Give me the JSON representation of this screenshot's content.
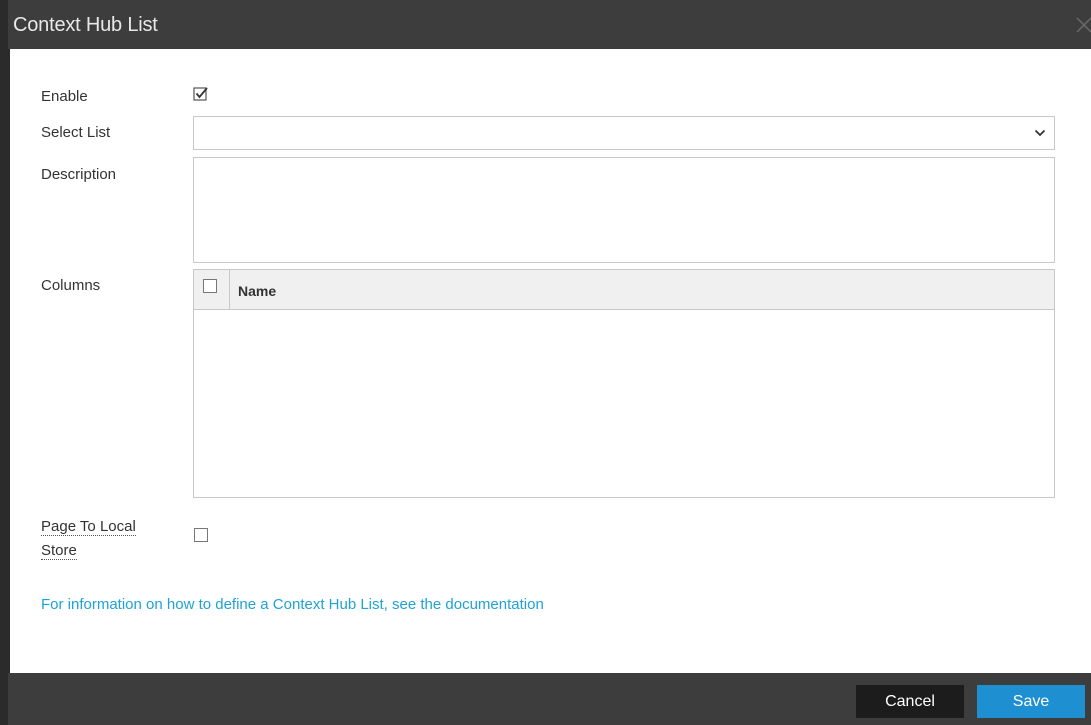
{
  "dialog": {
    "title": "Context Hub List"
  },
  "form": {
    "enable_label": "Enable",
    "select_list_label": "Select List",
    "select_list_value": "",
    "description_label": "Description",
    "description_value": "",
    "columns_label": "Columns",
    "columns_header": "Name",
    "page_to_local_store_line1": "Page To Local",
    "page_to_local_store_line2": "Store",
    "enable_checked": true,
    "page_to_local_store_checked": false
  },
  "link": {
    "doc_text": "For information on how to define a Context Hub List, see the documentation"
  },
  "footer": {
    "cancel_label": "Cancel",
    "save_label": "Save"
  },
  "colors": {
    "accent": "#1e8fd1",
    "link": "#1fa2d6",
    "chrome": "#3d3d3d"
  }
}
